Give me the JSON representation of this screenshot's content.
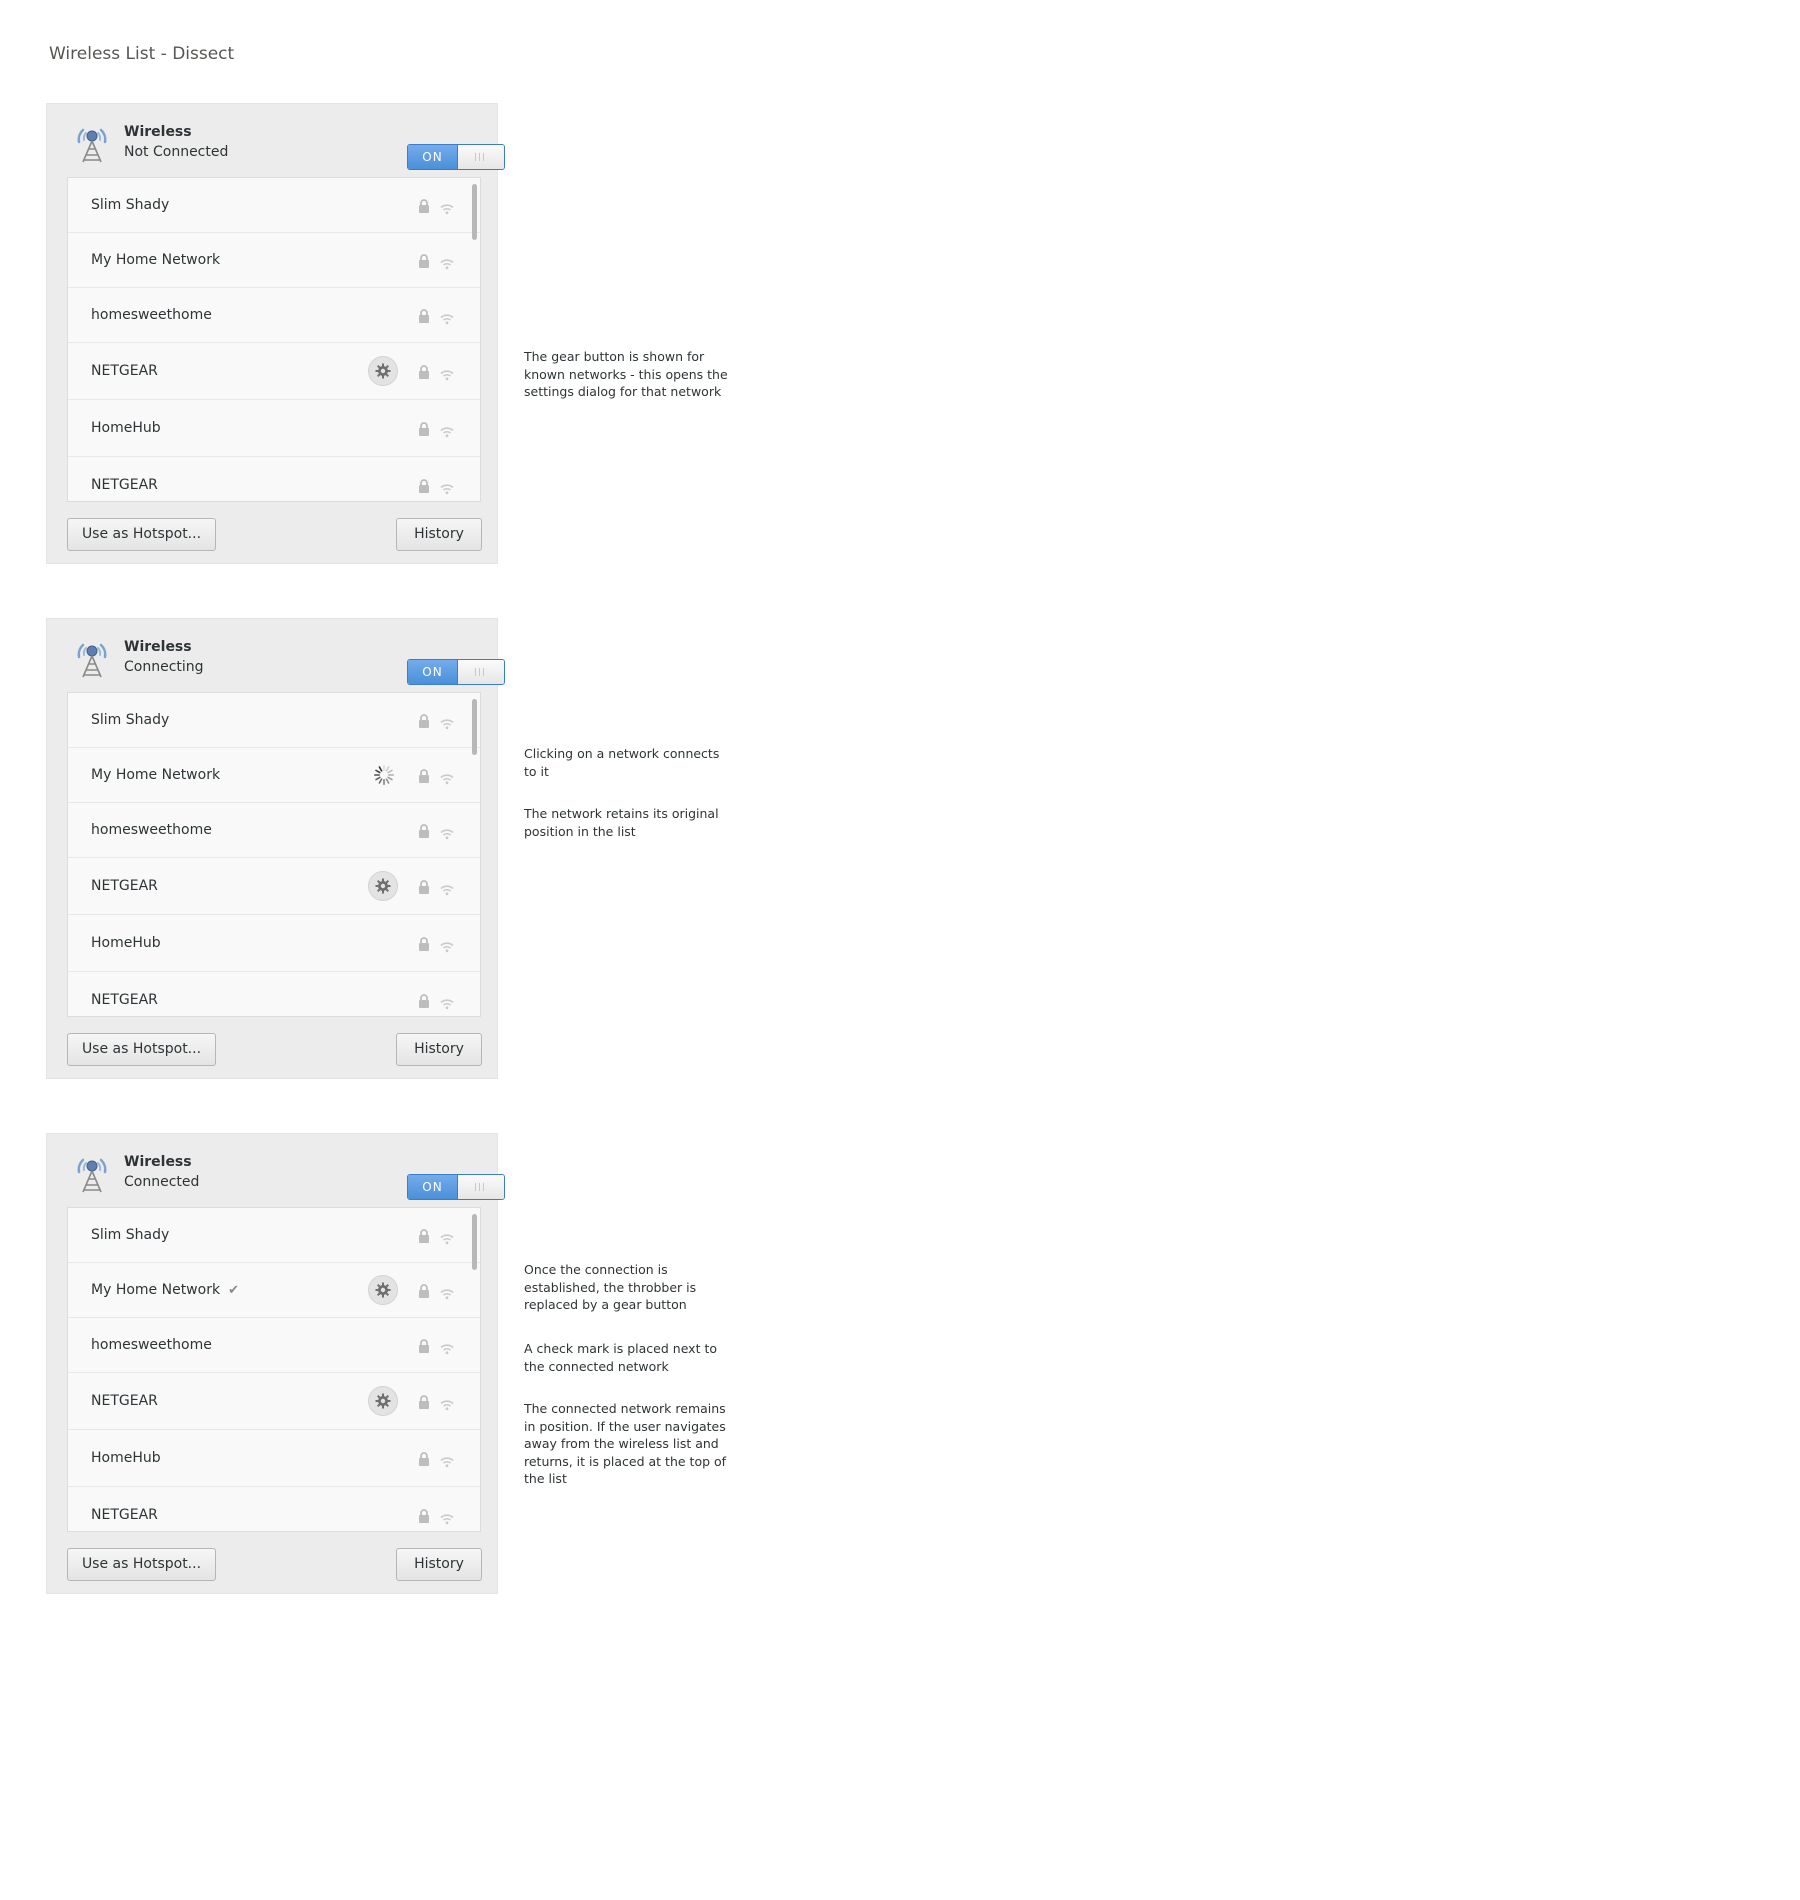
{
  "page_title": "Wireless List - Dissect",
  "panels": [
    {
      "title": "Wireless",
      "status": "Not Connected",
      "toggle_label": "ON",
      "networks": [
        {
          "name": "Slim Shady",
          "gear": false,
          "spinner": false,
          "check": false
        },
        {
          "name": "My Home Network",
          "gear": false,
          "spinner": false,
          "check": false
        },
        {
          "name": "homesweethome",
          "gear": false,
          "spinner": false,
          "check": false
        },
        {
          "name": "NETGEAR",
          "gear": true,
          "spinner": false,
          "check": false
        },
        {
          "name": "HomeHub",
          "gear": false,
          "spinner": false,
          "check": false
        },
        {
          "name": "NETGEAR",
          "gear": false,
          "spinner": false,
          "check": false
        }
      ],
      "hotspot_button": "Use as Hotspot...",
      "history_button": "History",
      "notes": [
        "The gear button is shown for known networks - this opens the settings dialog for that network"
      ]
    },
    {
      "title": "Wireless",
      "status": "Connecting",
      "toggle_label": "ON",
      "networks": [
        {
          "name": "Slim Shady",
          "gear": false,
          "spinner": false,
          "check": false
        },
        {
          "name": "My Home Network",
          "gear": false,
          "spinner": true,
          "check": false
        },
        {
          "name": "homesweethome",
          "gear": false,
          "spinner": false,
          "check": false
        },
        {
          "name": "NETGEAR",
          "gear": true,
          "spinner": false,
          "check": false
        },
        {
          "name": "HomeHub",
          "gear": false,
          "spinner": false,
          "check": false
        },
        {
          "name": "NETGEAR",
          "gear": false,
          "spinner": false,
          "check": false
        }
      ],
      "hotspot_button": "Use as Hotspot...",
      "history_button": "History",
      "notes": [
        "Clicking on a network connects to it",
        "The network retains its original position in the list"
      ]
    },
    {
      "title": "Wireless",
      "status": "Connected",
      "toggle_label": "ON",
      "networks": [
        {
          "name": "Slim Shady",
          "gear": false,
          "spinner": false,
          "check": false
        },
        {
          "name": "My Home Network",
          "gear": true,
          "spinner": false,
          "check": true
        },
        {
          "name": "homesweethome",
          "gear": false,
          "spinner": false,
          "check": false
        },
        {
          "name": "NETGEAR",
          "gear": true,
          "spinner": false,
          "check": false
        },
        {
          "name": "HomeHub",
          "gear": false,
          "spinner": false,
          "check": false
        },
        {
          "name": "NETGEAR",
          "gear": false,
          "spinner": false,
          "check": false
        }
      ],
      "hotspot_button": "Use as Hotspot...",
      "history_button": "History",
      "notes": [
        "Once the connection is established, the throbber is replaced by a gear button",
        "A check mark is placed next to the connected network",
        "The connected network remains in position. If the user navigates away from the wireless list and returns, it is placed at the top of the list"
      ]
    }
  ],
  "icons": {
    "antenna": "wireless-antenna-icon",
    "lock": "lock-icon",
    "wifi": "wifi-signal-icon",
    "gear": "gear-icon",
    "spinner": "spinner-icon",
    "check": "checkmark-icon"
  },
  "colors": {
    "accent": "#4a90d9",
    "panel_bg": "#ececec",
    "list_bg": "#f9f9f9",
    "icon_muted": "#b9b9b9"
  }
}
